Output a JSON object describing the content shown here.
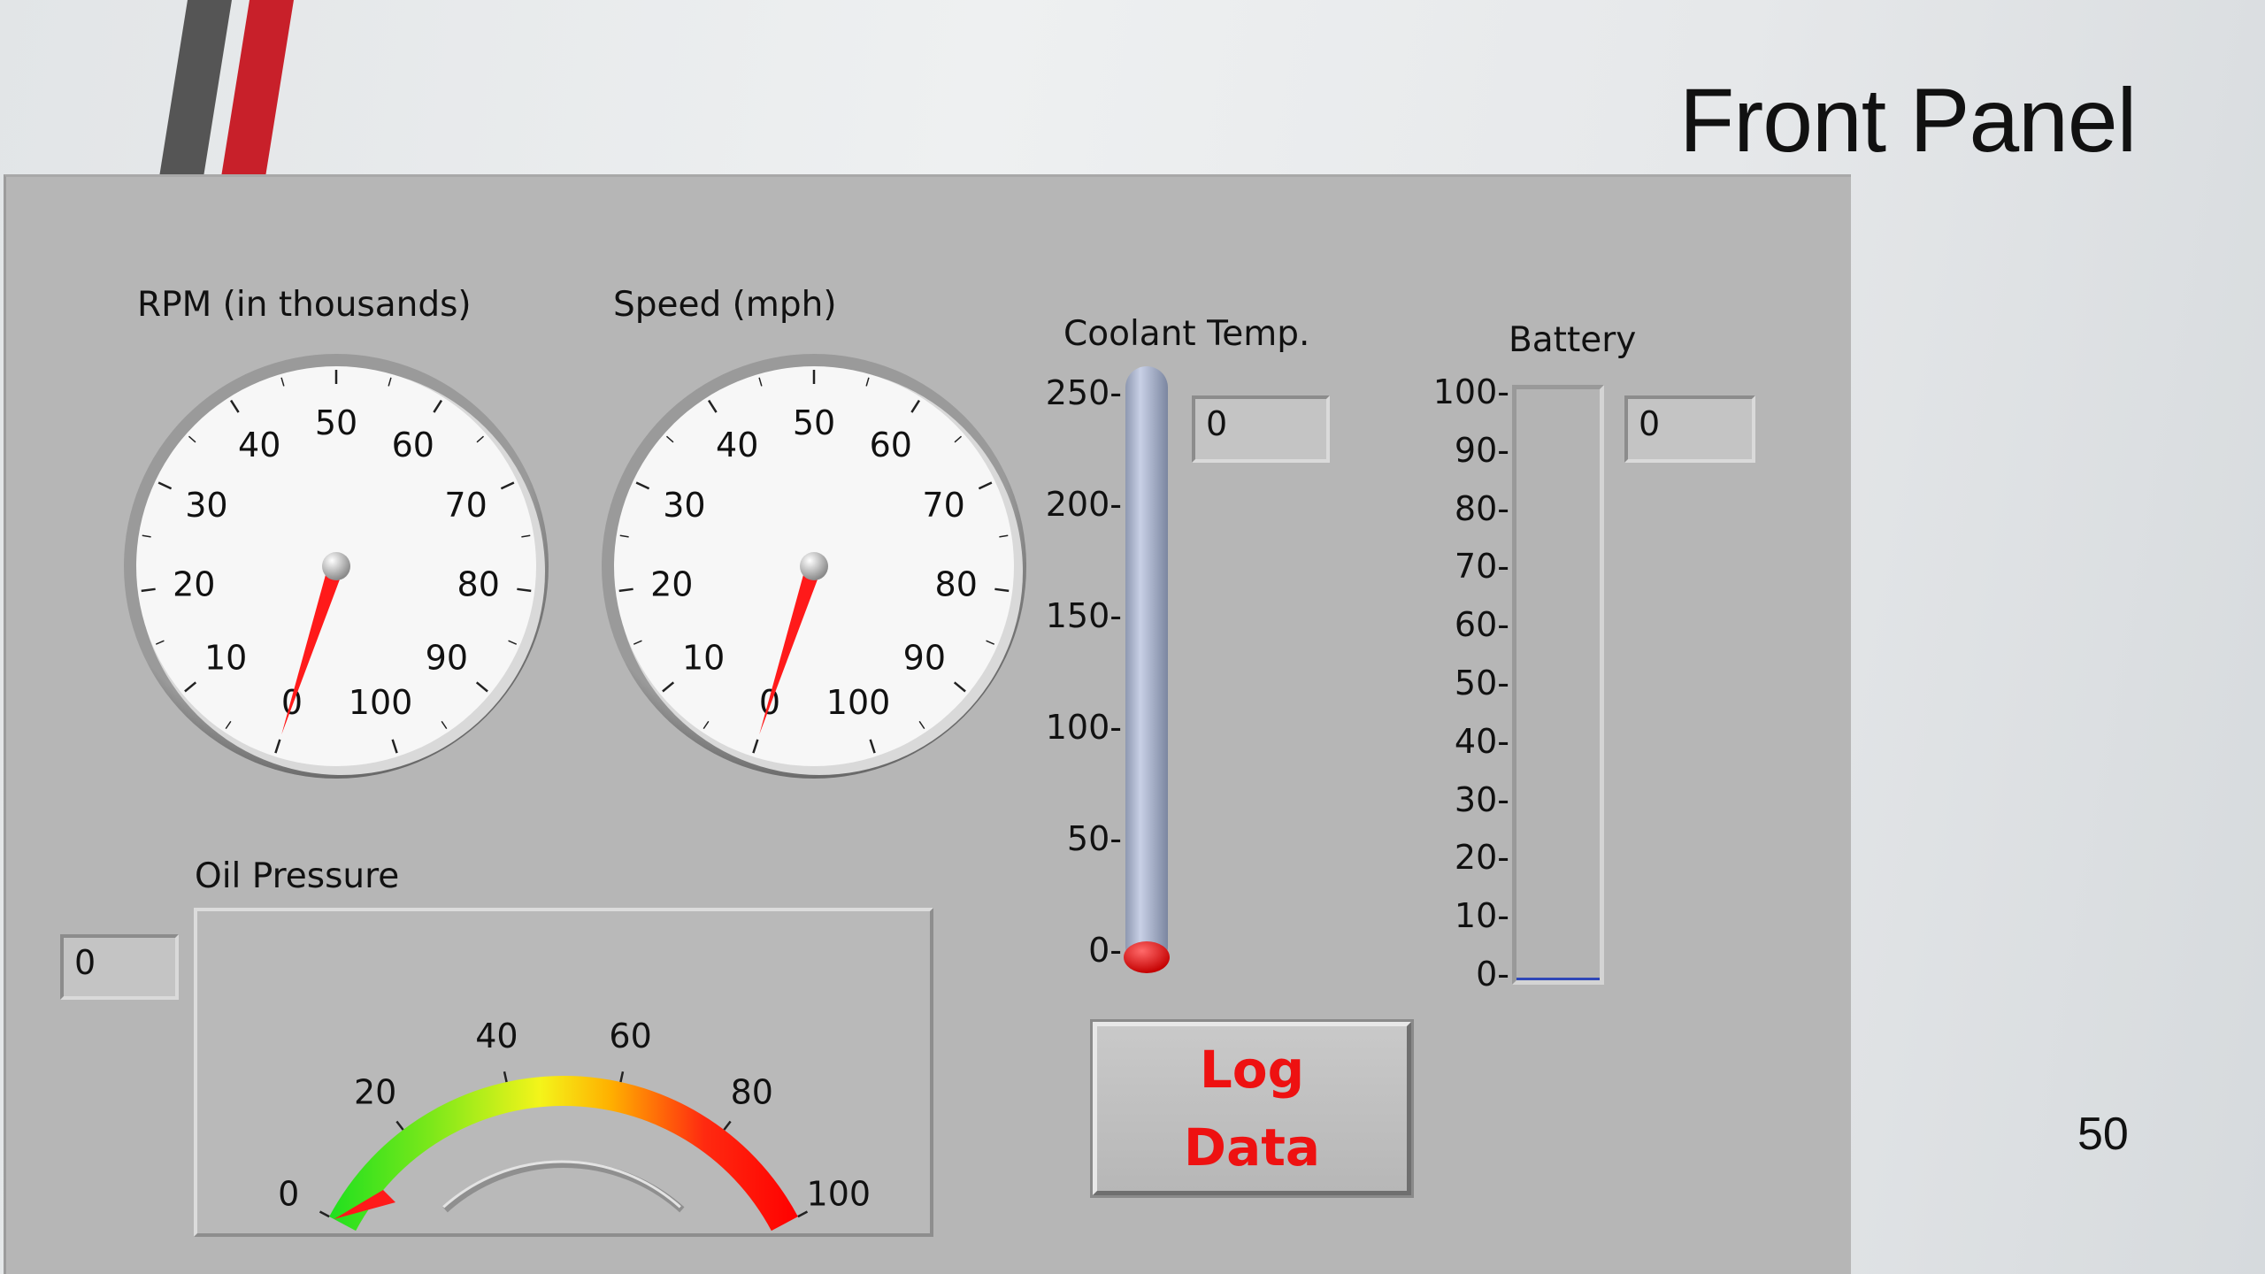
{
  "slide": {
    "title": "Front Panel",
    "page_number": "50"
  },
  "colors": {
    "panel": "#b6b6b6",
    "needle": "#ff1a1a",
    "accent_red": "#c8202a",
    "accent_gray": "#555555"
  },
  "rpm_gauge": {
    "label": "RPM (in thousands)",
    "ticks": [
      "0",
      "10",
      "20",
      "30",
      "40",
      "50",
      "60",
      "70",
      "80",
      "90",
      "100"
    ],
    "value": 0
  },
  "speed_gauge": {
    "label": "Speed (mph)",
    "ticks": [
      "0",
      "10",
      "20",
      "30",
      "40",
      "50",
      "60",
      "70",
      "80",
      "90",
      "100"
    ],
    "value": 0
  },
  "coolant": {
    "label": "Coolant Temp.",
    "scale": [
      "250-",
      "200-",
      "150-",
      "100-",
      "50-",
      "0-"
    ],
    "value": "0",
    "level": 0
  },
  "battery": {
    "label": "Battery",
    "scale": [
      "100-",
      "90-",
      "80-",
      "70-",
      "60-",
      "50-",
      "40-",
      "30-",
      "20-",
      "10-",
      "0-"
    ],
    "value": "0",
    "level": 0
  },
  "oil_pressure": {
    "label": "Oil Pressure",
    "ticks": [
      "0",
      "20",
      "40",
      "60",
      "80",
      "100"
    ],
    "value": "0"
  },
  "log_button": {
    "line1": "Log",
    "line2": "Data"
  }
}
